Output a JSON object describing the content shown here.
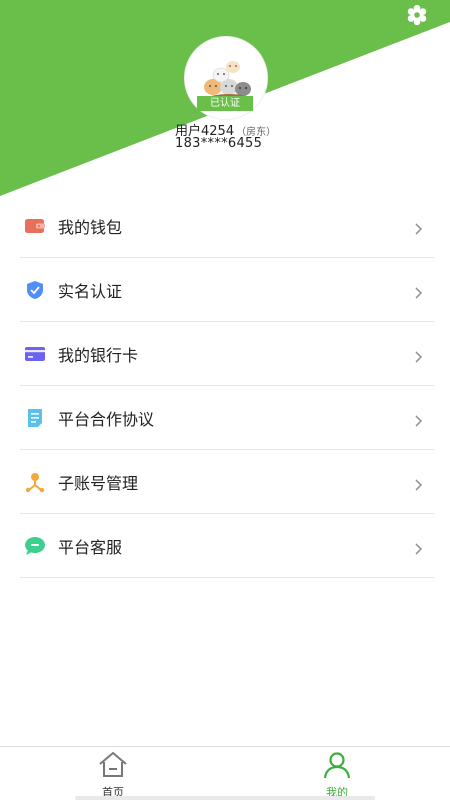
{
  "header": {
    "bg_color": "#6abf4b",
    "gear_icon": "gear-icon"
  },
  "profile": {
    "verified_badge": "已认证",
    "username": "用户4254",
    "role": "（房东）",
    "phone": "183****6455"
  },
  "menu": {
    "items": [
      {
        "label": "我的钱包",
        "icon": "wallet-icon",
        "color": "#e8705a"
      },
      {
        "label": "实名认证",
        "icon": "shield-check-icon",
        "color": "#4f8ff7"
      },
      {
        "label": "我的银行卡",
        "icon": "bank-card-icon",
        "color": "#6c63f0"
      },
      {
        "label": "平台合作协议",
        "icon": "document-icon",
        "color": "#5bc0eb"
      },
      {
        "label": "子账号管理",
        "icon": "sub-account-icon",
        "color": "#f2a93b"
      },
      {
        "label": "平台客服",
        "icon": "chat-bubble-icon",
        "color": "#3ccf8e"
      }
    ]
  },
  "tabbar": {
    "home_label": "首页",
    "mine_label": "我的",
    "active": "mine",
    "active_color": "#3cae3c"
  }
}
